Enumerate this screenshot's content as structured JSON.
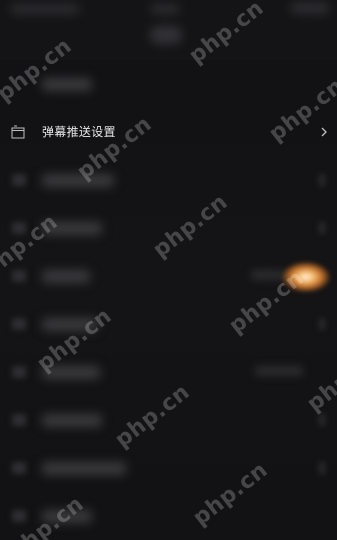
{
  "settings": {
    "active_row": {
      "label": "弹幕推送设置",
      "icon": "screen-icon",
      "chevron": "chevron-right-icon"
    }
  },
  "watermark": {
    "text": "php.cn"
  },
  "colors": {
    "background": "#121214",
    "label_text": "#e8e8ea",
    "icon_stroke": "#bfbfc2",
    "glow": "#f2a75a"
  }
}
